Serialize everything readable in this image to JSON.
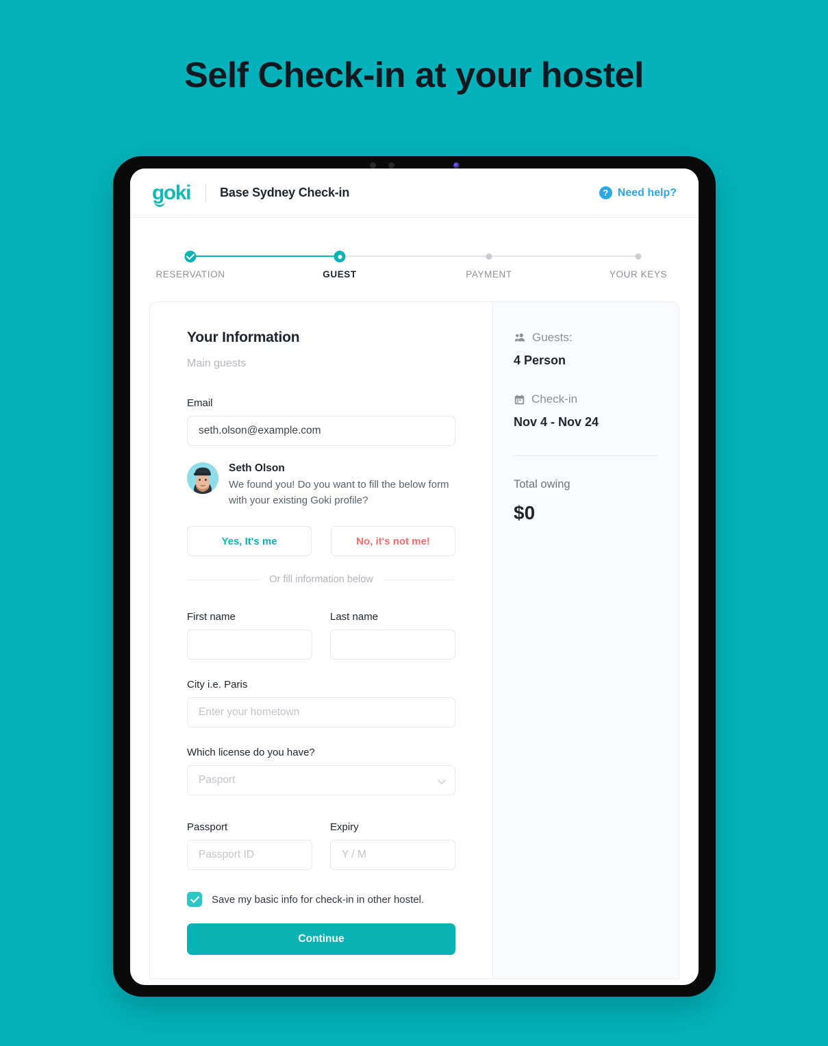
{
  "poster": {
    "headline": "Self Check-in at your hostel",
    "background_color": "#03b2ba"
  },
  "app_header": {
    "logo_text": "goki",
    "title": "Base Sydney Check-in",
    "help_label": "Need help?",
    "help_icon": "question-circle-icon",
    "help_color": "#2aa8e8"
  },
  "stepper": {
    "steps": [
      {
        "label": "RESERVATION",
        "state": "done"
      },
      {
        "label": "GUEST",
        "state": "active"
      },
      {
        "label": "PAYMENT",
        "state": "todo"
      },
      {
        "label": "YOUR KEYS",
        "state": "todo"
      }
    ],
    "accent_color": "#0ab3b3"
  },
  "form": {
    "title": "Your Information",
    "subtitle": "Main guests",
    "email": {
      "label": "Email",
      "value": "seth.olson@example.com"
    },
    "found_profile": {
      "name": "Seth Olson",
      "message": "We found you! Do you want to fill the below form with your existing Goki profile?",
      "yes_label": "Yes, It's me",
      "no_label": "No, it's not me!"
    },
    "or_divider": "Or fill information below",
    "first_name": {
      "label": "First name",
      "value": "",
      "placeholder": ""
    },
    "last_name": {
      "label": "Last name",
      "value": "",
      "placeholder": ""
    },
    "city": {
      "label": "City i.e. Paris",
      "value": "",
      "placeholder": "Enter your hometown"
    },
    "license": {
      "label": "Which license do you have?",
      "selected": "",
      "placeholder": "Pasport",
      "options": [
        "Pasport"
      ]
    },
    "passport": {
      "label": "Passport",
      "value": "",
      "placeholder": "Passport ID"
    },
    "expiry": {
      "label": "Expiry",
      "value": "",
      "placeholder": "Y / M"
    },
    "save_checkbox": {
      "label": "Save my basic info for check-in in other hostel.",
      "checked": true
    },
    "continue_label": "Continue"
  },
  "summary": {
    "guests_label": "Guests:",
    "guests_value": "4 Person",
    "checkin_label": "Check-in",
    "checkin_value": "Nov 4 - Nov 24",
    "total_label": "Total owing",
    "total_value": "$0"
  }
}
